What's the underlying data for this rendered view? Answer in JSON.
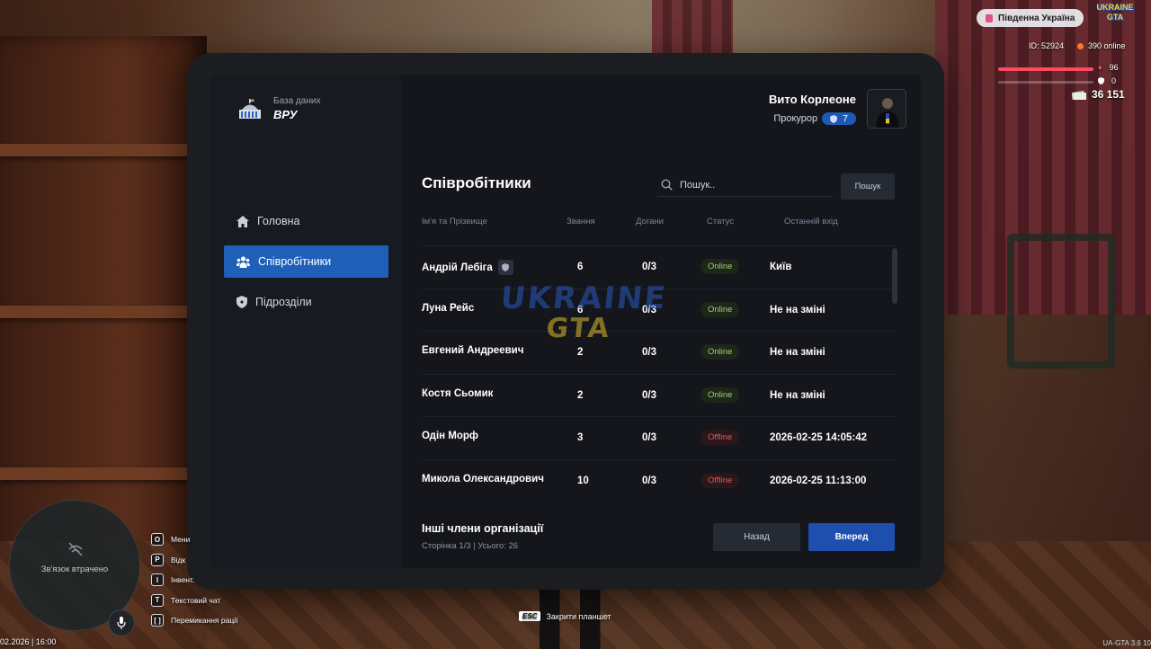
{
  "app": {
    "subtitle": "База даних",
    "title": "ВРУ"
  },
  "user": {
    "name": "Вито Корлеоне",
    "role": "Прокурор",
    "rank": "7"
  },
  "sidebar": {
    "items": [
      {
        "label": "Головна",
        "icon": "home-icon"
      },
      {
        "label": "Співробітники",
        "icon": "people-icon",
        "active": true
      },
      {
        "label": "Підрозділи",
        "icon": "shield-icon"
      }
    ]
  },
  "page": {
    "title": "Співробітники"
  },
  "search": {
    "placeholder": "Пошук..",
    "button": "Пошук"
  },
  "table": {
    "headers": [
      "Ім'я та Прізвище",
      "Звання",
      "Догани",
      "Статус",
      "Останній вхід"
    ],
    "rows": [
      {
        "name": "Андрій Лебіга",
        "rank": "6",
        "warnings": "0/3",
        "status": "Online",
        "last": "Київ",
        "badge": "shield-icon"
      },
      {
        "name": "Луна Рейс",
        "rank": "6",
        "warnings": "0/3",
        "status": "Online",
        "last": "Не на зміні"
      },
      {
        "name": "Евгений Андреевич",
        "rank": "2",
        "warnings": "0/3",
        "status": "Online",
        "last": "Не на зміні"
      },
      {
        "name": "Костя Сьомик",
        "rank": "2",
        "warnings": "0/3",
        "status": "Online",
        "last": "Не на зміні"
      },
      {
        "name": "Одін Морф",
        "rank": "3",
        "warnings": "0/3",
        "status": "Offline",
        "last": "2026-02-25 14:05:42"
      },
      {
        "name": "Микола Олександрович",
        "rank": "10",
        "warnings": "0/3",
        "status": "Offline",
        "last": "2026-02-25 11:13:00"
      }
    ]
  },
  "footer": {
    "title": "Інші члени організації",
    "meta": "Сторінка 1/3 | Усього: 26",
    "back": "Назад",
    "next": "Вперед"
  },
  "watermark": {
    "line1": "UKRAINE",
    "line2": "GTA"
  },
  "hud": {
    "region": "Південна Україна",
    "logo_line1": "UKRAINE",
    "logo_line2": "GTA",
    "id": "ID: 52924",
    "online": "390 online",
    "health": "96",
    "armor": "0",
    "money": "36 151",
    "map_status": "Зв'язок втрачено",
    "datetime": "02.2026 | 16:00",
    "version": "UA-GTA 3.6 10",
    "hotkeys": [
      {
        "key": "O",
        "label": "Мени"
      },
      {
        "key": "P",
        "label": "Відк"
      },
      {
        "key": "I",
        "label": "Інвент."
      },
      {
        "key": "T",
        "label": "Текстовий чат"
      },
      {
        "key": "[ ]",
        "label": "Перемикання рації"
      }
    ],
    "esc_key": "ESC",
    "esc_label": "Закрити планшет"
  },
  "colors": {
    "accent": "#1f5fb8",
    "online": "#9ed16f",
    "offline": "#e0575c",
    "panel": "#14161c"
  }
}
